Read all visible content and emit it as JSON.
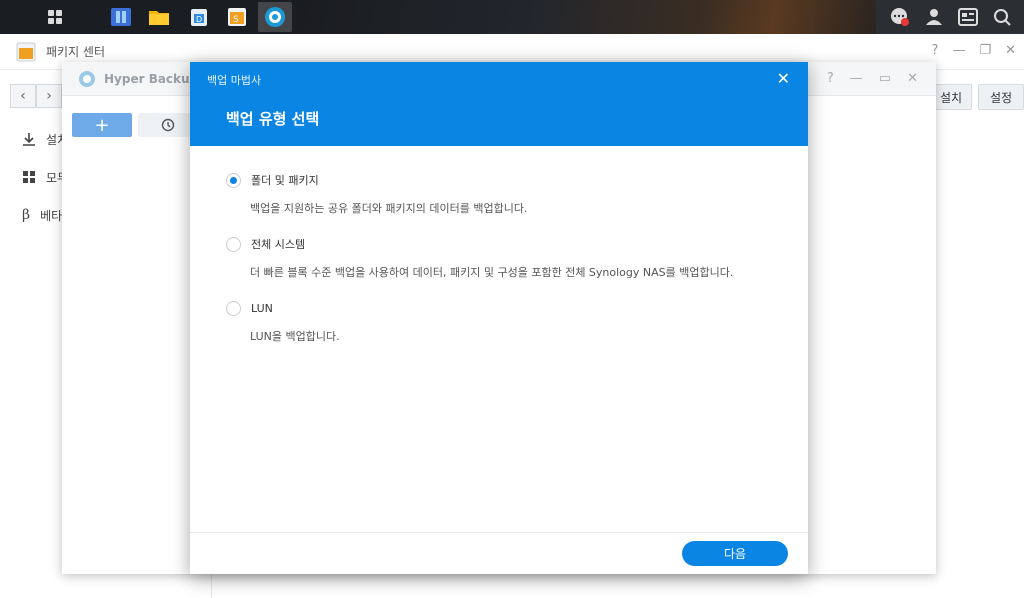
{
  "package_center": {
    "title": "패키지 센터",
    "sidebar": [
      {
        "label": "설치",
        "icon": "download-icon"
      },
      {
        "label": "모두",
        "icon": "grid-icon"
      },
      {
        "label": "베타",
        "icon": "beta-icon"
      }
    ],
    "buttons": {
      "install": "설치",
      "settings": "설정"
    }
  },
  "hyper_backup": {
    "title": "Hyper Backup",
    "add_label": "+"
  },
  "wizard": {
    "window_title": "백업 마법사",
    "heading": "백업 유형 선택",
    "options": [
      {
        "label": "폴더 및 패키지",
        "description": "백업을 지원하는 공유 폴더와 패키지의 데이터를 백업합니다.",
        "selected": true
      },
      {
        "label": "전체 시스템",
        "description": "더 빠른 블록 수준 백업을 사용하여 데이터, 패키지 및 구성을 포함한 전체 Synology NAS를 백업합니다.",
        "selected": false
      },
      {
        "label": "LUN",
        "description": "LUN을 백업합니다.",
        "selected": false
      }
    ],
    "next_label": "다음"
  },
  "colors": {
    "accent": "#0b85e3",
    "taskbar": "#1a1d22"
  }
}
